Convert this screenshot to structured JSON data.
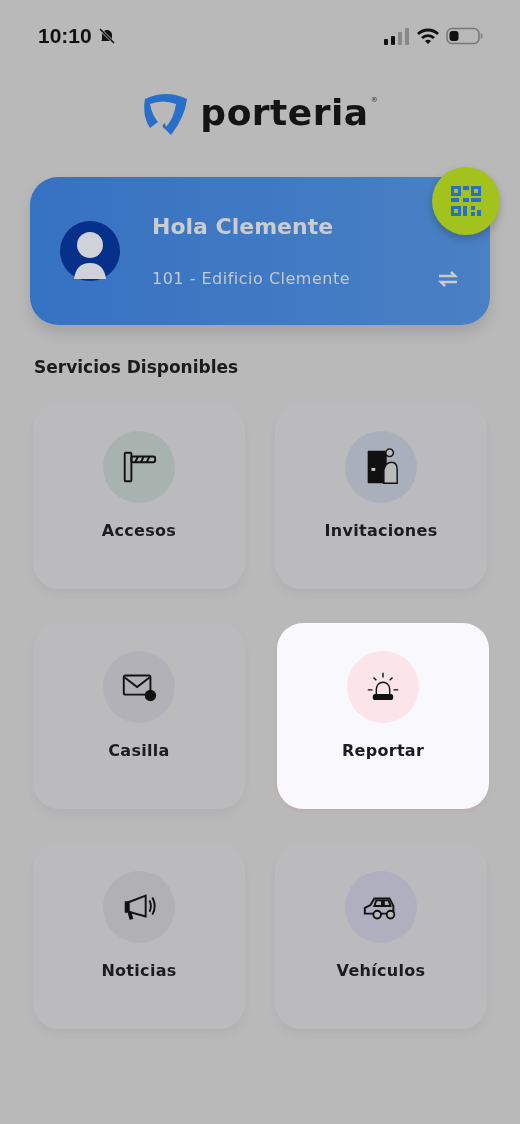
{
  "status_bar": {
    "time": "10:10",
    "muted": true
  },
  "logo": {
    "text": "porteria",
    "mark": "®"
  },
  "profile": {
    "greeting": "Hola Clemente",
    "unit": "101 - Edificio Clemente"
  },
  "section_title": "Servicios Disponibles",
  "services": [
    {
      "kind": "barrier",
      "label": "Accesos",
      "color": "#a8b2ae",
      "highlighted": false
    },
    {
      "kind": "door",
      "label": "Invitaciones",
      "color": "#a9b0bc",
      "highlighted": false
    },
    {
      "kind": "mail",
      "label": "Casilla",
      "color": "#b2b1b8",
      "highlighted": false
    },
    {
      "kind": "siren",
      "label": "Reportar",
      "color": "#fbe5ea",
      "highlighted": true
    },
    {
      "kind": "megaphone",
      "label": "Noticias",
      "color": "#b1b0b5",
      "highlighted": false
    },
    {
      "kind": "car",
      "label": "Vehículos",
      "color": "#b0afc0",
      "highlighted": false
    }
  ]
}
